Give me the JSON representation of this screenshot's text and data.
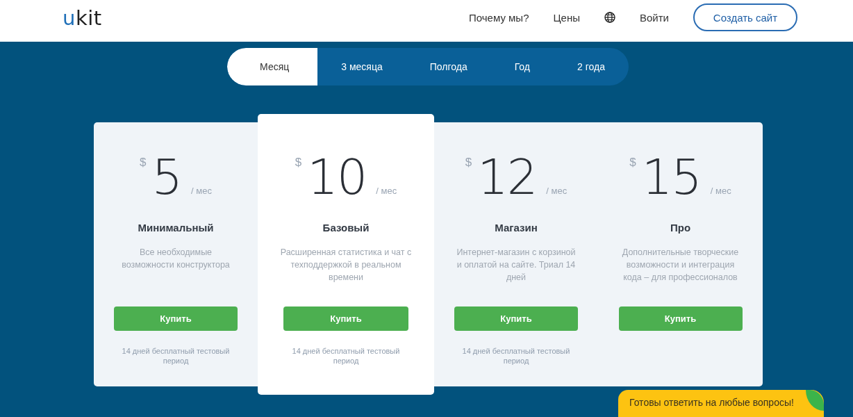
{
  "header": {
    "logo": {
      "accent": "u",
      "rest": "kit"
    },
    "nav": [
      "Почему мы?",
      "Цены"
    ],
    "login": "Войти",
    "cta": "Создать сайт"
  },
  "period_tabs": [
    {
      "label": "Месяц",
      "selected": true
    },
    {
      "label": "3 месяца",
      "selected": false
    },
    {
      "label": "Полгода",
      "selected": false
    },
    {
      "label": "Год",
      "selected": false
    },
    {
      "label": "2 года",
      "selected": false
    }
  ],
  "plans": [
    {
      "currency": "$",
      "price": "5",
      "period": "/ мес",
      "name": "Минимальный",
      "description": "Все необходимые возможности конструктора",
      "button": "Купить",
      "trial": "14 дней бесплатный тестовый период",
      "featured": false
    },
    {
      "currency": "$",
      "price": "10",
      "period": "/ мес",
      "name": "Базовый",
      "description": "Расширенная статистика и чат с техподдержкой в реальном времени",
      "button": "Купить",
      "trial": "14 дней бесплатный тестовый период",
      "featured": true
    },
    {
      "currency": "$",
      "price": "12",
      "period": "/ мес",
      "name": "Магазин",
      "description": "Интернет-магазин с корзиной и оплатой на сайте. Триал 14 дней",
      "button": "Купить",
      "trial": "14 дней бесплатный тестовый период",
      "featured": false
    },
    {
      "currency": "$",
      "price": "15",
      "period": "/ мес",
      "name": "Про",
      "description": "Дополнительные творческие возможности и интеграция кода – для профессионалов",
      "button": "Купить",
      "featured": false
    }
  ],
  "chat_bubble": {
    "text": "Готовы ответить на любые вопросы!"
  }
}
